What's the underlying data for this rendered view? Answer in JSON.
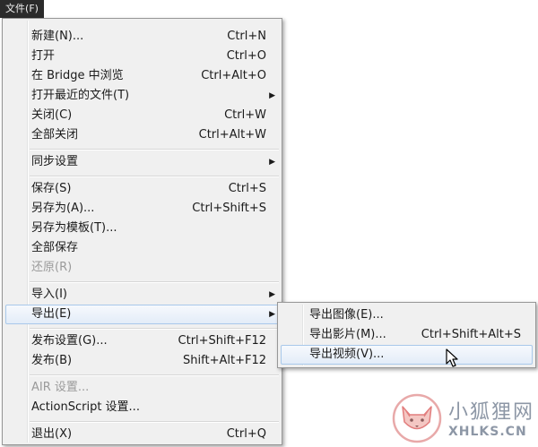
{
  "menubar": {
    "file_menu_label": "文件(F)"
  },
  "file_menu": {
    "new": {
      "label": "新建(N)...",
      "shortcut": "Ctrl+N"
    },
    "open": {
      "label": "打开",
      "shortcut": "Ctrl+O"
    },
    "browse_in_bridge": {
      "label": "在 Bridge 中浏览",
      "shortcut": "Ctrl+Alt+O"
    },
    "open_recent": {
      "label": "打开最近的文件(T)"
    },
    "close": {
      "label": "关闭(C)",
      "shortcut": "Ctrl+W"
    },
    "close_all": {
      "label": "全部关闭",
      "shortcut": "Ctrl+Alt+W"
    },
    "sync_settings": {
      "label": "同步设置"
    },
    "save": {
      "label": "保存(S)",
      "shortcut": "Ctrl+S"
    },
    "save_as": {
      "label": "另存为(A)...",
      "shortcut": "Ctrl+Shift+S"
    },
    "save_as_template": {
      "label": "另存为模板(T)..."
    },
    "save_all": {
      "label": "全部保存"
    },
    "revert": {
      "label": "还原(R)",
      "disabled": true
    },
    "import": {
      "label": "导入(I)"
    },
    "export": {
      "label": "导出(E)",
      "highlighted": true
    },
    "publish_settings": {
      "label": "发布设置(G)...",
      "shortcut": "Ctrl+Shift+F12"
    },
    "publish": {
      "label": "发布(B)",
      "shortcut": "Shift+Alt+F12"
    },
    "air_settings": {
      "label": "AIR 设置...",
      "disabled": true
    },
    "actionscript_settings": {
      "label": "ActionScript 设置..."
    },
    "exit": {
      "label": "退出(X)",
      "shortcut": "Ctrl+Q"
    }
  },
  "export_submenu": {
    "export_image": {
      "label": "导出图像(E)..."
    },
    "export_movie": {
      "label": "导出影片(M)...",
      "shortcut": "Ctrl+Shift+Alt+S"
    },
    "export_video": {
      "label": "导出视频(V)...",
      "highlighted": true
    }
  },
  "watermark": {
    "title": "小狐狸网",
    "domain": "XHLKS.CN"
  },
  "colors": {
    "menu_bg": "#f0f0f0",
    "highlight_border": "#a8c8ea",
    "disabled_text": "#9a9a9a",
    "watermark": "#8d97a6"
  }
}
